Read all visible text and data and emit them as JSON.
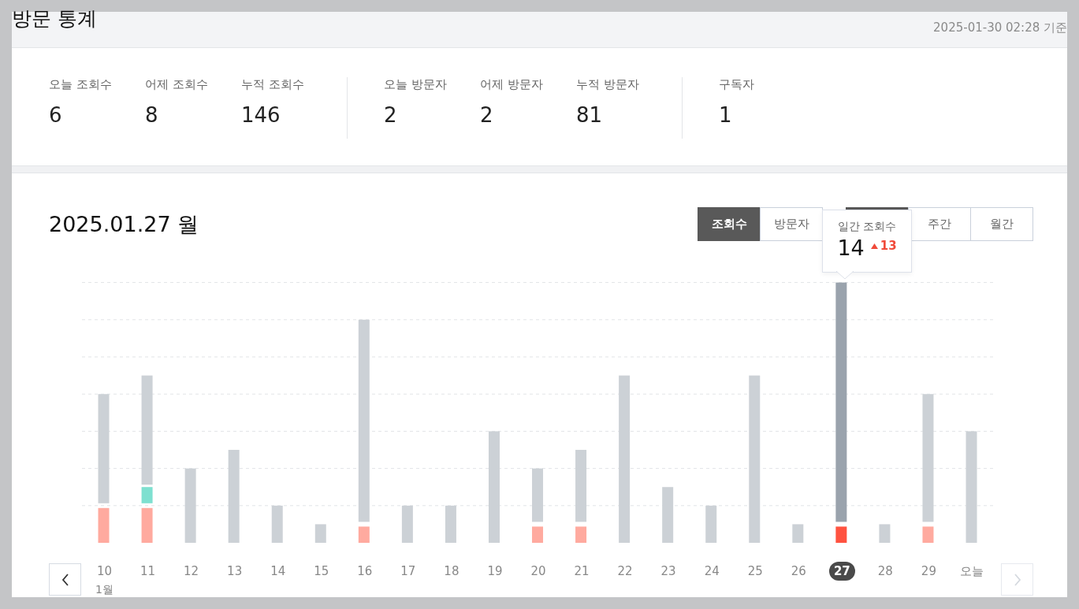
{
  "header": {
    "title": "방문 통계",
    "updated": "2025-01-30 02:28 기준"
  },
  "stat_groups": [
    {
      "items": [
        {
          "label": "오늘 조회수",
          "value": "6"
        },
        {
          "label": "어제 조회수",
          "value": "8"
        },
        {
          "label": "누적 조회수",
          "value": "146"
        }
      ]
    },
    {
      "items": [
        {
          "label": "오늘 방문자",
          "value": "2"
        },
        {
          "label": "어제 방문자",
          "value": "2"
        },
        {
          "label": "누적 방문자",
          "value": "81"
        }
      ]
    },
    {
      "items": [
        {
          "label": "구독자",
          "value": "1"
        }
      ]
    }
  ],
  "chart": {
    "date_title": "2025.01.27 월",
    "metric_tabs": [
      {
        "label": "조회수",
        "selected": true
      },
      {
        "label": "방문자",
        "selected": false
      }
    ],
    "period_tabs": [
      {
        "selected": true
      },
      {
        "label": "주간",
        "selected": false
      },
      {
        "label": "월간",
        "selected": false
      }
    ],
    "tooltip": {
      "title": "일간 조회수",
      "value": "14",
      "change": "13"
    },
    "days": [
      {
        "label": "10",
        "selected": false,
        "sub": "1월"
      },
      {
        "label": "11",
        "selected": false
      },
      {
        "label": "12",
        "selected": false
      },
      {
        "label": "13",
        "selected": false
      },
      {
        "label": "14",
        "selected": false
      },
      {
        "label": "15",
        "selected": false
      },
      {
        "label": "16",
        "selected": false
      },
      {
        "label": "17",
        "selected": false
      },
      {
        "label": "18",
        "selected": false
      },
      {
        "label": "19",
        "selected": false
      },
      {
        "label": "20",
        "selected": false
      },
      {
        "label": "21",
        "selected": false
      },
      {
        "label": "22",
        "selected": false
      },
      {
        "label": "23",
        "selected": false
      },
      {
        "label": "24",
        "selected": false
      },
      {
        "label": "25",
        "selected": false
      },
      {
        "label": "26",
        "selected": false
      },
      {
        "label": "27",
        "selected": true
      },
      {
        "label": "28",
        "selected": false
      },
      {
        "label": "29",
        "selected": false
      },
      {
        "label": "오늘",
        "selected": false
      }
    ],
    "next_disabled": true
  }
}
